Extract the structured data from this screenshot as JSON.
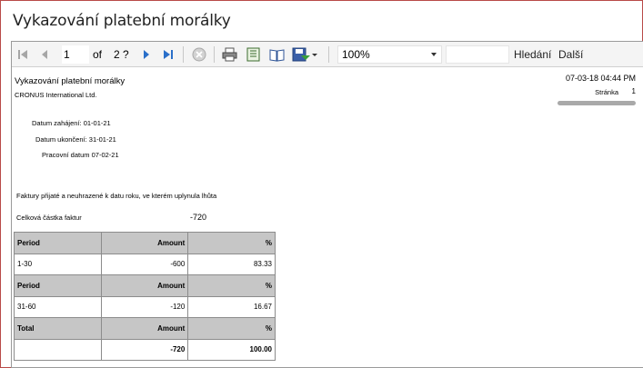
{
  "window": {
    "title": "Vykazování platební morálky"
  },
  "toolbar": {
    "current_page": "1",
    "of_label": "of",
    "total_pages": "2 ?",
    "zoom": "100%",
    "search_value": "",
    "find_label": "Hledání",
    "next_label": "Další"
  },
  "report": {
    "title": "Vykazování platební morálky",
    "company": "CRONUS International Ltd.",
    "datetime": "07-03-18 04:44 PM",
    "page_label": "Stránka",
    "page_number": "1",
    "start_date": "Datum zahájení: 01-01-21",
    "end_date": "Datum ukončení: 31-01-21",
    "work_date": "Pracovní datum 07-02-21",
    "description": "Faktury přijaté a neuhrazené k datu roku, ve kterém uplynula lhůta",
    "total_label": "Celková částka faktur",
    "total_value": "-720",
    "table": {
      "rows": [
        {
          "type": "header",
          "c1": "Period",
          "c2": "Amount",
          "c3": "%"
        },
        {
          "type": "data",
          "c1": "1-30",
          "c2": "-600",
          "c3": "83.33"
        },
        {
          "type": "header",
          "c1": "Period",
          "c2": "Amount",
          "c3": "%"
        },
        {
          "type": "data",
          "c1": "31-60",
          "c2": "-120",
          "c3": "16.67"
        },
        {
          "type": "header",
          "c1": "Total",
          "c2": "Amount",
          "c3": "%"
        },
        {
          "type": "total",
          "c1": "",
          "c2": "-720",
          "c3": "100.00"
        }
      ]
    }
  },
  "colors": {
    "frame": "#b94a48",
    "header_row": "#c6c6c6",
    "nav_blue": "#2a6fc9"
  },
  "icons": [
    "first-page-icon",
    "previous-page-icon",
    "next-page-icon",
    "last-page-icon",
    "stop-icon",
    "print-icon",
    "print-layout-icon",
    "page-setup-icon",
    "export-icon"
  ]
}
